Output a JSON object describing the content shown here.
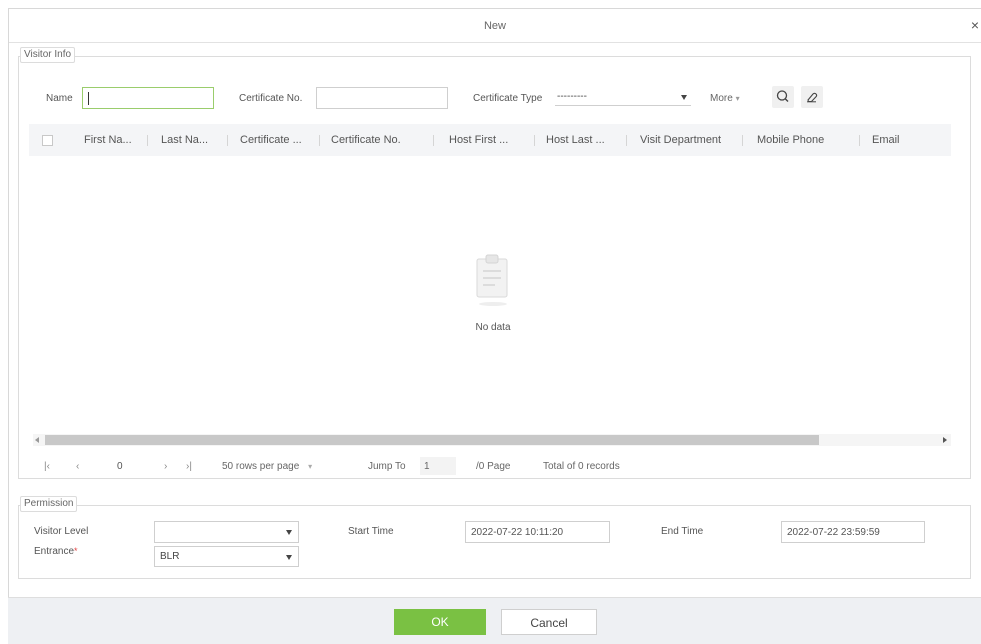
{
  "dialog": {
    "title": "New",
    "close_glyph": "×"
  },
  "visitor_info": {
    "legend": "Visitor Info",
    "name_label": "Name",
    "name_value": "",
    "certificate_no_label": "Certificate No.",
    "certificate_no_value": "",
    "certificate_type_label": "Certificate Type",
    "certificate_type_value": "---------",
    "more_label": "More",
    "more_caret": "▾",
    "search_icon": "search-icon",
    "clear_icon": "eraser-icon"
  },
  "table": {
    "columns": [
      "First Na...",
      "Last Na...",
      "Certificate ...",
      "Certificate No.",
      "Host First ...",
      "Host Last ...",
      "Visit Department",
      "Mobile Phone",
      "Email"
    ],
    "rows": [],
    "empty_text": "No data"
  },
  "pagination": {
    "first": "|‹",
    "prev": "‹",
    "current": "0",
    "next": "›",
    "last": "›|",
    "rows_per_page": "50 rows per page",
    "rows_caret": "▾",
    "jump_to_label": "Jump To",
    "jump_to_value": "1",
    "page_total": "/0 Page",
    "total_records": "Total of 0 records"
  },
  "permission": {
    "legend": "Permission",
    "visitor_level_label": "Visitor Level",
    "visitor_level_value": "",
    "start_time_label": "Start Time",
    "start_time_value": "2022-07-22 10:11:20",
    "end_time_label": "End Time",
    "end_time_value": "2022-07-22 23:59:59",
    "entrance_label": "Entrance",
    "entrance_required_mark": "*",
    "entrance_value": "BLR"
  },
  "footer": {
    "ok_label": "OK",
    "cancel_label": "Cancel"
  },
  "colors": {
    "accent_green": "#7ac143",
    "active_border": "#9acd6c",
    "required_red": "#e24545"
  }
}
